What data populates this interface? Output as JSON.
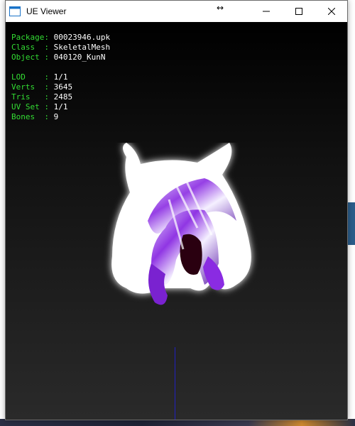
{
  "window": {
    "title": "UE Viewer"
  },
  "info": {
    "package_key": "Package:",
    "package_value": "00023946.upk",
    "class_key": "Class  :",
    "class_value": "SkeletalMesh",
    "object_key": "Object :",
    "object_value": "040120_KunN",
    "lod_key": "LOD    :",
    "lod_value": "1/1",
    "verts_key": "Verts  :",
    "verts_value": "3645",
    "tris_key": "Tris   :",
    "tris_value": "2485",
    "uvset_key": "UV Set :",
    "uvset_value": "1/1",
    "bones_key": "Bones  :",
    "bones_value": "9"
  },
  "colors": {
    "info_key": "#33dd33",
    "info_value": "#ffffff",
    "axis": "#2020c0"
  },
  "icons": {
    "app": "ue-viewer-icon",
    "minimize": "minimize-icon",
    "maximize": "maximize-icon",
    "close": "close-icon",
    "cursor": "resize-horizontal-cursor-icon"
  }
}
